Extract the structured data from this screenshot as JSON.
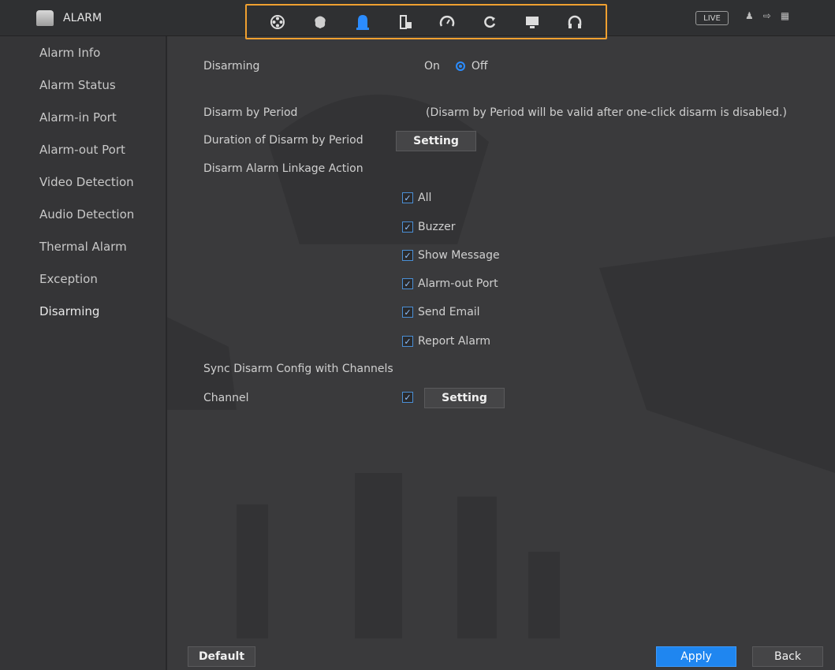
{
  "header": {
    "app_title": "ALARM",
    "modules": [
      {
        "icon": "film-reel-icon"
      },
      {
        "icon": "brain-icon"
      },
      {
        "icon": "alarm-bell-icon",
        "active": true
      },
      {
        "icon": "storage-icon"
      },
      {
        "icon": "gauge-icon"
      },
      {
        "icon": "refresh-icon"
      },
      {
        "icon": "monitor-icon"
      },
      {
        "icon": "headset-icon"
      }
    ],
    "live_label": "LIVE",
    "right_icons": [
      "user-icon",
      "logout-icon",
      "grid-icon"
    ]
  },
  "sidebar": {
    "items": [
      {
        "label": "Alarm Info"
      },
      {
        "label": "Alarm Status"
      },
      {
        "label": "Alarm-in Port"
      },
      {
        "label": "Alarm-out Port"
      },
      {
        "label": "Video Detection"
      },
      {
        "label": "Audio Detection"
      },
      {
        "label": "Thermal Alarm"
      },
      {
        "label": "Exception"
      },
      {
        "label": "Disarming"
      }
    ],
    "active": "Disarming"
  },
  "main": {
    "disarming_label": "Disarming",
    "on_label": "On",
    "off_label": "Off",
    "disarm_by_period_label": "Disarm by Period",
    "disarm_by_period_note": "(Disarm by Period will be valid after one-click disarm is disabled.)",
    "duration_label": "Duration of Disarm by Period",
    "setting_label": "Setting",
    "linkage_label": "Disarm Alarm Linkage Action",
    "linkage_options": [
      {
        "label": "All",
        "checked": true
      },
      {
        "label": "Buzzer",
        "checked": true
      },
      {
        "label": "Show Message",
        "checked": true
      },
      {
        "label": "Alarm-out Port",
        "checked": true
      },
      {
        "label": "Send Email",
        "checked": true
      },
      {
        "label": "Report Alarm",
        "checked": true
      }
    ],
    "sync_label": "Sync Disarm Config with Channels",
    "channel_label": "Channel",
    "channel_setting_label": "Setting"
  },
  "footer": {
    "default_label": "Default",
    "apply_label": "Apply",
    "back_label": "Back"
  },
  "colors": {
    "accent": "#2b8cff",
    "highlight_border": "#f0a030",
    "background": "#3a3a3c"
  }
}
